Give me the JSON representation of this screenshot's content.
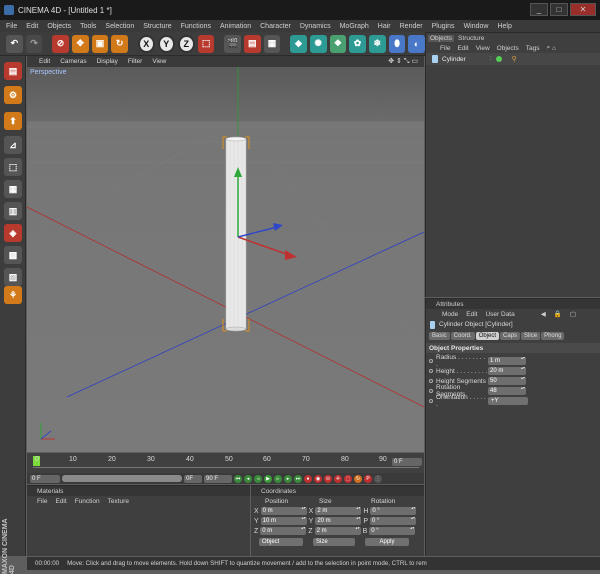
{
  "window": {
    "title": "CINEMA 4D - [Untitled 1 *]",
    "minimize": "_",
    "maximize": "□",
    "close": "✕"
  },
  "menubar": [
    "File",
    "Edit",
    "Objects",
    "Tools",
    "Selection",
    "Structure",
    "Functions",
    "Animation",
    "Character",
    "Dynamics",
    "MoGraph",
    "Hair",
    "Render",
    "Plugins",
    "Window",
    "Help"
  ],
  "viewport": {
    "menu": [
      "Edit",
      "Cameras",
      "Display",
      "Filter",
      "View"
    ],
    "nav_icons": "✥ ⇕ ⤡ ▭",
    "label": "Perspective"
  },
  "timeline": {
    "ticks": [
      "0",
      "10",
      "20",
      "30",
      "40",
      "50",
      "60",
      "70",
      "80",
      "90"
    ],
    "current_frame": "0 F"
  },
  "playbar": {
    "start": "0 F",
    "end": "90 F",
    "end_short": "0F"
  },
  "objects_panel": {
    "tabs": [
      "Objects",
      "Structure"
    ],
    "menu": [
      "File",
      "Edit",
      "View",
      "Objects",
      "Tags"
    ],
    "items": [
      {
        "name": "Cylinder"
      }
    ]
  },
  "attributes_panel": {
    "title": "Attributes",
    "menu": [
      "Mode",
      "Edit",
      "User Data"
    ],
    "object_title": "Cylinder Object [Cylinder]",
    "tabs": [
      "Basic",
      "Coord.",
      "Object",
      "Caps",
      "Slice",
      "Phong"
    ],
    "active_tab": "Object",
    "section": "Object Properties",
    "props": [
      {
        "label": "Radius . . . . . . . . .",
        "value": "1 m"
      },
      {
        "label": "Height . . . . . . . . .",
        "value": "20 m"
      },
      {
        "label": "Height Segments",
        "value": "50"
      },
      {
        "label": "Rotation Segments",
        "value": "48"
      },
      {
        "label": "Orientation . . . . . .",
        "value": "+Y"
      }
    ]
  },
  "materials_panel": {
    "title": "Materials",
    "menu": [
      "File",
      "Edit",
      "Function",
      "Texture"
    ]
  },
  "coordinates_panel": {
    "title": "Coordinates",
    "headers": [
      "Position",
      "Size",
      "Rotation"
    ],
    "rows": [
      {
        "axis": "X",
        "pos": "0 m",
        "saxis": "X",
        "size": "2 m",
        "raxis": "H",
        "rot": "0 °"
      },
      {
        "axis": "Y",
        "pos": "10 m",
        "saxis": "Y",
        "size": "20 m",
        "raxis": "P",
        "rot": "0 °"
      },
      {
        "axis": "Z",
        "pos": "0 m",
        "saxis": "Z",
        "size": "2 m",
        "raxis": "B",
        "rot": "0 °"
      }
    ],
    "mode_select": "Object",
    "size_select": "Size",
    "apply": "Apply"
  },
  "status": {
    "time": "00:00:00",
    "message": "Move: Click and drag to move elements. Hold down SHIFT to quantize movement / add to the selection in point mode, CTRL to rem"
  },
  "brand": "MAXON CINEMA 4D"
}
